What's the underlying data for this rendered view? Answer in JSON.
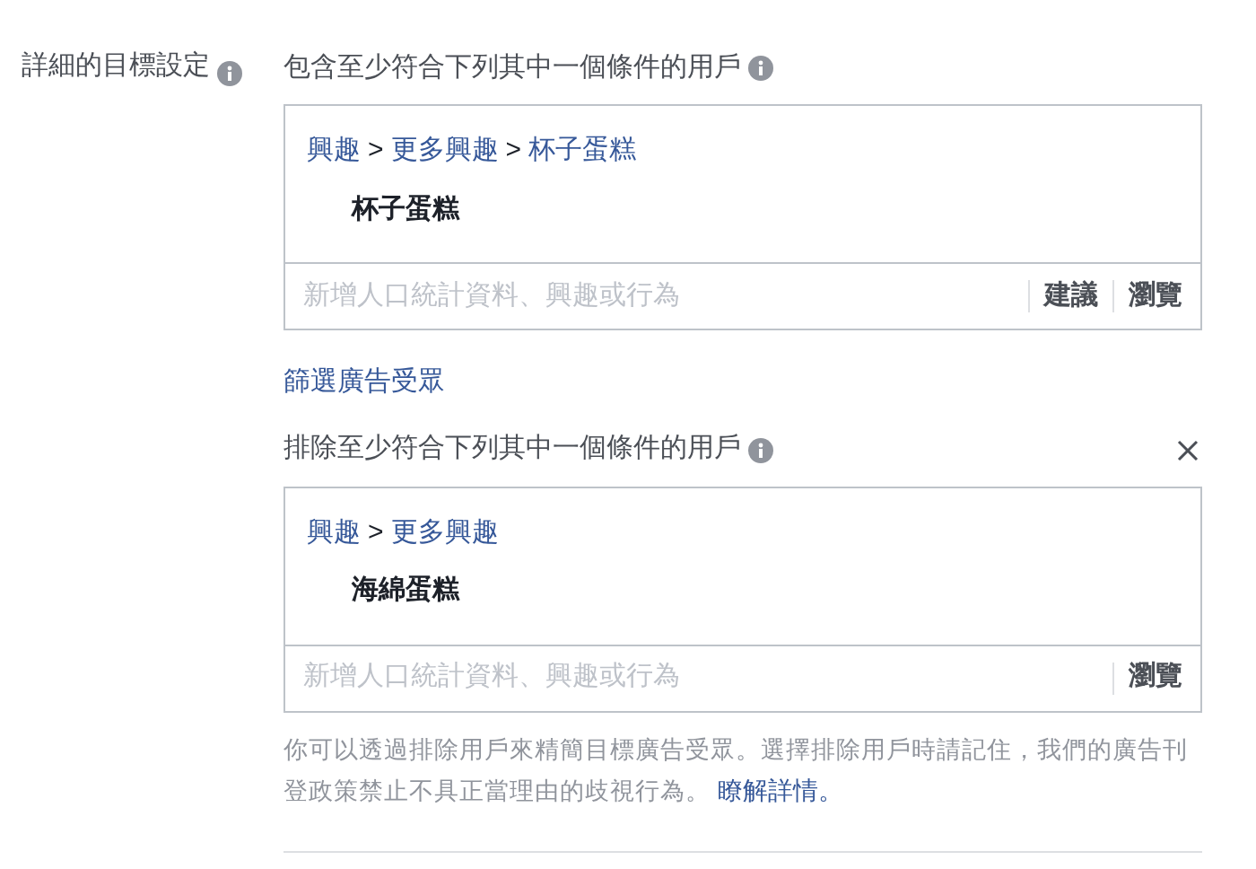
{
  "label": "詳細的目標設定",
  "sections": [
    {
      "heading": "包含至少符合下列其中一個條件的用戶",
      "closable": false,
      "separator": ">",
      "breadcrumb": [
        "興趣",
        "更多興趣",
        "杯子蛋糕"
      ],
      "item": "杯子蛋糕",
      "placeholder": "新增人口統計資料、興趣或行為",
      "actions": [
        "建議",
        "瀏覽"
      ]
    },
    {
      "heading": "排除至少符合下列其中一個條件的用戶",
      "closable": true,
      "separator": ">",
      "breadcrumb": [
        "興趣",
        "更多興趣"
      ],
      "item": "海綿蛋糕",
      "placeholder": "新增人口統計資料、興趣或行為",
      "actions": [
        "瀏覽"
      ]
    }
  ],
  "filter_link": "篩選廣告受眾",
  "note": {
    "text": "你可以透過排除用戶來精簡目標廣告受眾。選擇排除用戶時請記住，我們的廣告刊登政策禁止不具正當理由的歧視行為。",
    "link": "瞭解詳情。"
  }
}
